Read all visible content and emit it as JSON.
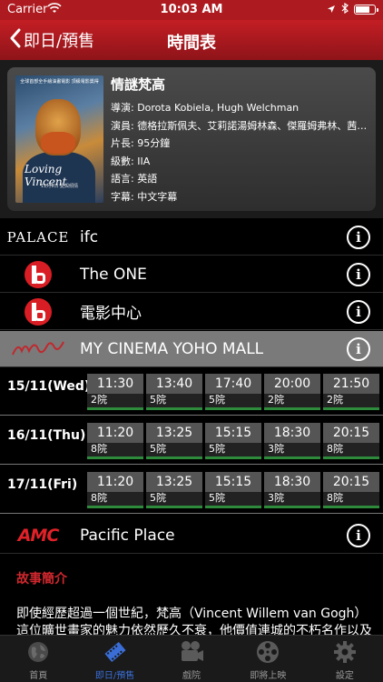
{
  "status_bar": {
    "carrier": "Carrier",
    "time": "10:03 AM"
  },
  "nav": {
    "back_label": "即日/預售",
    "title": "時間表"
  },
  "movie": {
    "title": "情謎梵高",
    "director": "導演: Dorota Kobiela, Hugh Welchman",
    "cast": "演員: 德格拉斯佩夫、艾莉諾湯姆林森、傑羅姆弗林、茜爾莎...",
    "length": "片長: 95分鐘",
    "rating": "級數: IIA",
    "language": "語言: 英語",
    "subtitles": "字幕: 中文字幕",
    "poster": {
      "top_text": "全球首部全手繪油畫電影 頂級電影獎得",
      "logo_text": "Loving Vincent",
      "bottom_text": "11月9日 愛與傾情"
    }
  },
  "cinemas": [
    {
      "logo_text": "PALACE",
      "name": "ifc"
    },
    {
      "name": "The ONE"
    },
    {
      "name": "電影中心"
    },
    {
      "logo_text": "MY",
      "name": "MY CINEMA YOHO MALL"
    },
    {
      "logo_text": "AMC",
      "name": "Pacific Place"
    }
  ],
  "showtimes": [
    {
      "date": "15/11(Wed)",
      "slots": [
        {
          "time": "11:30",
          "house": "2院"
        },
        {
          "time": "13:40",
          "house": "5院"
        },
        {
          "time": "17:40",
          "house": "5院"
        },
        {
          "time": "20:00",
          "house": "2院"
        },
        {
          "time": "21:50",
          "house": "2院"
        }
      ]
    },
    {
      "date": "16/11(Thu)",
      "slots": [
        {
          "time": "11:20",
          "house": "8院"
        },
        {
          "time": "13:25",
          "house": "5院"
        },
        {
          "time": "15:15",
          "house": "5院"
        },
        {
          "time": "18:30",
          "house": "3院"
        },
        {
          "time": "20:15",
          "house": "8院"
        }
      ]
    },
    {
      "date": "17/11(Fri)",
      "slots": [
        {
          "time": "11:20",
          "house": "8院"
        },
        {
          "time": "13:25",
          "house": "5院"
        },
        {
          "time": "15:15",
          "house": "5院"
        },
        {
          "time": "18:30",
          "house": "3院"
        },
        {
          "time": "20:15",
          "house": "8院"
        }
      ]
    }
  ],
  "synopsis": {
    "heading": "故事簡介",
    "text": "即使經歷超過一個世紀，梵高（Vincent Willem van Gogh）這位曠世畫家的魅力依然歷久不衰，他價值連城的不朽名作以及"
  },
  "tabs": [
    {
      "label": "首頁",
      "icon": "globe-icon"
    },
    {
      "label": "即日/預售",
      "icon": "film-strip-icon",
      "active": true
    },
    {
      "label": "戲院",
      "icon": "projector-icon"
    },
    {
      "label": "即將上映",
      "icon": "film-reel-icon"
    },
    {
      "label": "設定",
      "icon": "gear-icon"
    }
  ],
  "colors": {
    "brand_red": "#c31e24",
    "active_tab": "#3a6ed6",
    "slot_bar": "#2e8b3b"
  }
}
